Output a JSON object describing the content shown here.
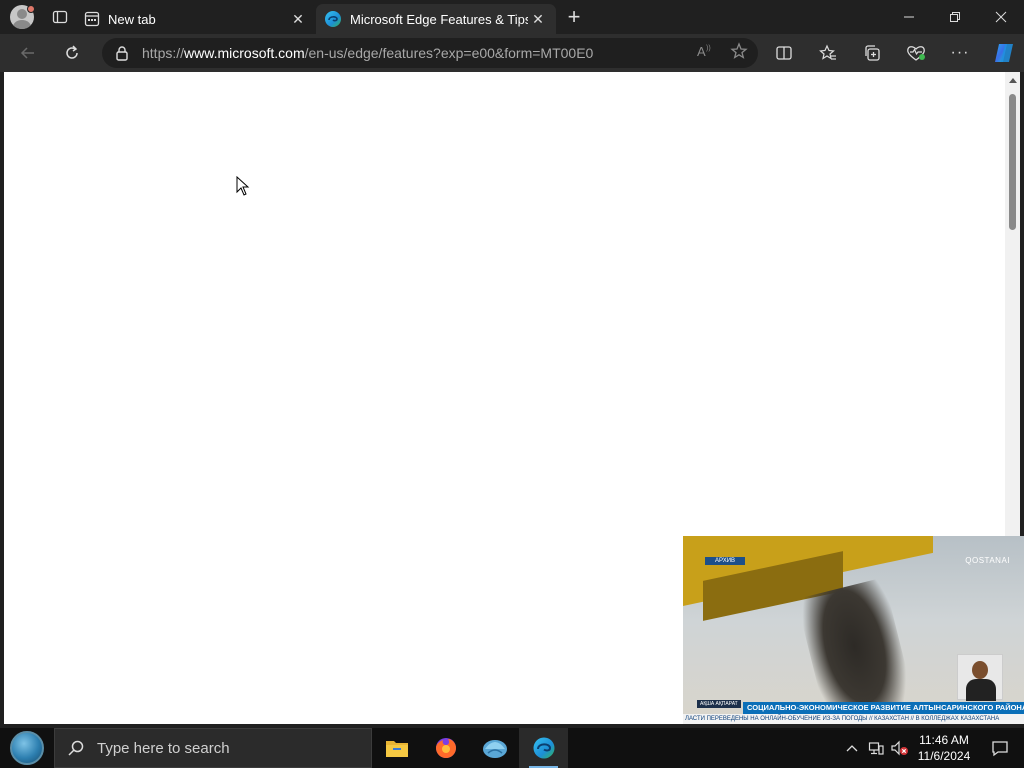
{
  "tabs": [
    {
      "title": "New tab",
      "active": false
    },
    {
      "title": "Microsoft Edge Features & Tips",
      "active": true
    }
  ],
  "address_bar": {
    "url_prefix": "https://",
    "url_host": "www.microsoft.com",
    "url_path": "/en-us/edge/features?exp=e00&form=MT00E0"
  },
  "video_overlay": {
    "archive_label": "АРХИВ",
    "channel_logo": "QOSTANAI",
    "lower_tag": "АҚША АҚПАРАТ",
    "headline": "СОЦИАЛЬНО-ЭКОНОМИЧЕСКОЕ РАЗВИТИЕ АЛТЫНСАРИНСКОГО РАЙОНА",
    "ticker": "ЛАСТИ ПЕРЕВЕДЕНЫ НА ОНЛАЙН-ОБУЧЕНИЕ ИЗ-ЗА ПОГОДЫ  //  КАЗАХСТАН  //  В КОЛЛЕДЖАХ КАЗАХСТАНА"
  },
  "taskbar": {
    "search_placeholder": "Type here to search",
    "time": "11:46 AM",
    "date": "11/6/2024"
  },
  "colors": {
    "tab_bar": "#202020",
    "toolbar": "#2e2e2e",
    "taskbar": "#101010",
    "accent": "#78b6e6",
    "headline_bar": "#0b6fb8"
  }
}
